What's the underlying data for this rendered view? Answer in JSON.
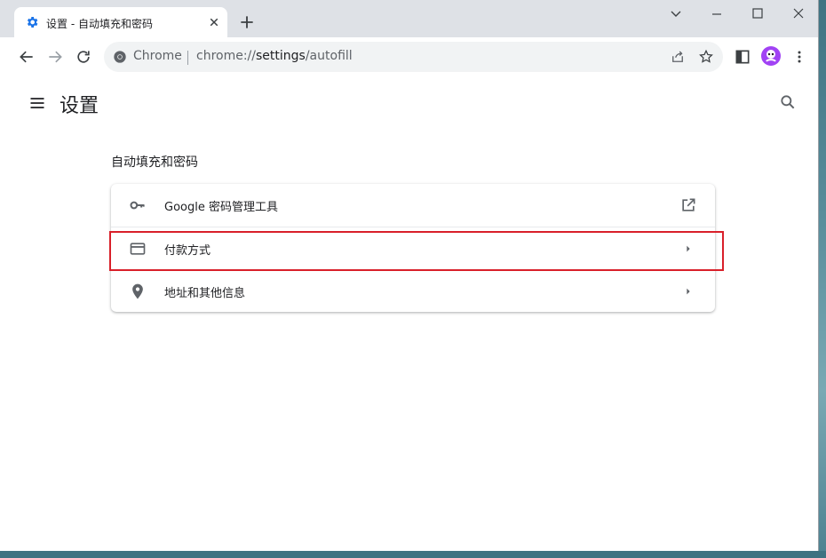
{
  "tab": {
    "title": "设置 - 自动填充和密码",
    "favicon": "gear-icon",
    "close_icon": "close-icon"
  },
  "window_controls": [
    "chevron-down-icon",
    "minimize-icon",
    "maximize-icon",
    "close-icon"
  ],
  "toolbar": {
    "back_icon": "arrow-left-icon",
    "forward_icon": "arrow-right-icon",
    "reload_icon": "reload-icon",
    "omnibox": {
      "site_label": "Chrome",
      "url_scheme": "chrome://",
      "url_host": "settings",
      "url_path": "/autofill"
    },
    "side_panel_icon": "side-panel-icon",
    "menu_icon": "kebab-menu-icon"
  },
  "settings": {
    "page_title": "设置",
    "section_title": "自动填充和密码",
    "items": [
      {
        "label": "Google 密码管理工具",
        "icon": "key-icon",
        "action_icon": "open-external-icon"
      },
      {
        "label": "付款方式",
        "icon": "credit-card-icon",
        "action_icon": "arrow-right-icon"
      },
      {
        "label": "地址和其他信息",
        "icon": "location-pin-icon",
        "action_icon": "arrow-right-icon"
      }
    ]
  },
  "colors": {
    "tabstrip": "#dee1e6",
    "accent_blue": "#1a73e8",
    "highlight_red": "#d9202a",
    "avatar_purple": "#a142f4",
    "icon_gray": "#5f6368"
  }
}
